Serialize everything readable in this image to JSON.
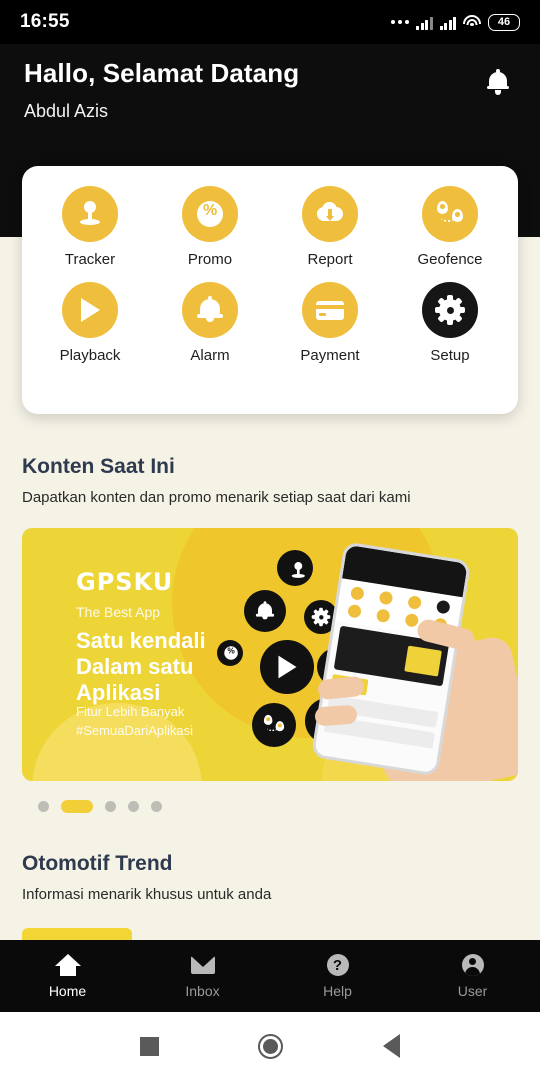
{
  "statusbar": {
    "time": "16:55",
    "battery": "46",
    "icons": [
      "more-dots-icon",
      "signal-bars-icon",
      "signal-bars-icon",
      "wifi-icon",
      "battery-icon"
    ]
  },
  "header": {
    "greeting": "Hallo, Selamat Datang",
    "username": "Abdul Azis",
    "notification_icon": "bell-icon"
  },
  "menu": {
    "items": [
      {
        "label": "Tracker",
        "icon": "location-pin-icon",
        "style": "yellow"
      },
      {
        "label": "Promo",
        "icon": "percent-icon",
        "style": "yellow"
      },
      {
        "label": "Report",
        "icon": "cloud-download-icon",
        "style": "yellow"
      },
      {
        "label": "Geofence",
        "icon": "geofence-pins-icon",
        "style": "yellow"
      },
      {
        "label": "Playback",
        "icon": "play-icon",
        "style": "yellow"
      },
      {
        "label": "Alarm",
        "icon": "bell-icon",
        "style": "yellow"
      },
      {
        "label": "Payment",
        "icon": "credit-card-icon",
        "style": "yellow"
      },
      {
        "label": "Setup",
        "icon": "gear-icon",
        "style": "dark"
      }
    ]
  },
  "sections": {
    "konten": {
      "title": "Konten Saat Ini",
      "subtitle": "Dapatkan konten dan promo menarik setiap saat dari kami"
    },
    "otomotif": {
      "title": "Otomotif Trend",
      "subtitle": "Informasi menarik khusus untuk anda"
    }
  },
  "banner": {
    "logo": "GPSKU",
    "tagline": "The Best App",
    "headline": "Satu kendali\nDalam satu\nAplikasi",
    "sub1": "Fitur Lebih Banyak",
    "sub2": "#SemuaDariAplikasi",
    "bg_color": "#EED537",
    "pager": {
      "count": 5,
      "active_index": 1
    }
  },
  "bottom_nav": {
    "items": [
      {
        "label": "Home",
        "icon": "home-icon",
        "active": true
      },
      {
        "label": "Inbox",
        "icon": "envelope-icon",
        "active": false
      },
      {
        "label": "Help",
        "icon": "question-mark-icon",
        "active": false
      },
      {
        "label": "User",
        "icon": "person-icon",
        "active": false
      }
    ],
    "help_glyph": "?"
  },
  "android_nav": {
    "recents": "square-icon",
    "home": "circle-icon",
    "back": "triangle-back-icon"
  }
}
